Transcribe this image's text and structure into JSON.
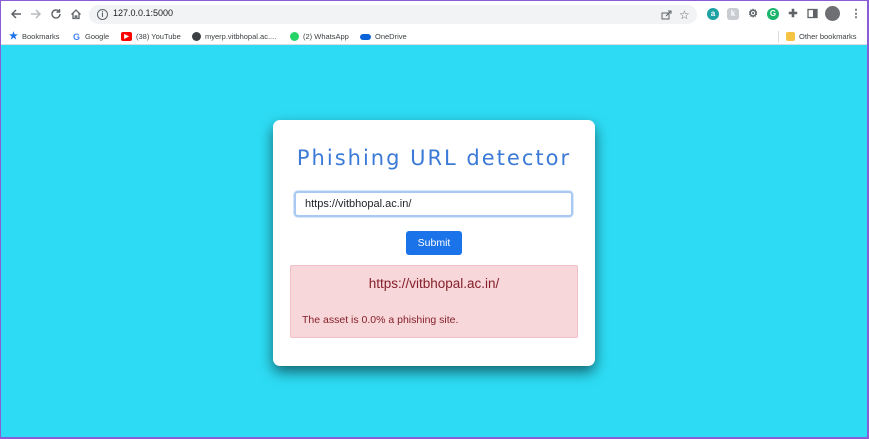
{
  "browser": {
    "url": "127.0.0.1:5000",
    "bookmarks": [
      {
        "label": "Bookmarks",
        "icon": "star-icon"
      },
      {
        "label": "Google",
        "icon": "google-icon"
      },
      {
        "label": "(38) YouTube",
        "icon": "youtube-icon"
      },
      {
        "label": "myerp.vitbhopal.ac....",
        "icon": "globe-icon"
      },
      {
        "label": "(2) WhatsApp",
        "icon": "whatsapp-icon"
      },
      {
        "label": "OneDrive",
        "icon": "onedrive-icon"
      }
    ],
    "other_bookmarks": "Other bookmarks"
  },
  "app": {
    "title": "Phishing URL detector",
    "input_value": "https://vitbhopal.ac.in/",
    "submit_label": "Submit",
    "result": {
      "url": "https://vitbhopal.ac.in/",
      "message": "The asset is 0.0% a phishing site."
    }
  },
  "colors": {
    "page_background": "#2ddcf4",
    "title": "#3b7ad6",
    "button": "#1a73e8",
    "alert_background": "#f8d7da",
    "alert_text": "#842029"
  }
}
